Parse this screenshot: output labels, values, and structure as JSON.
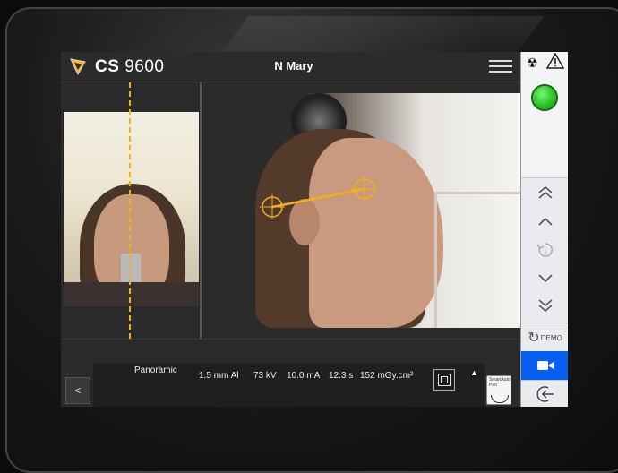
{
  "header": {
    "brand_prefix": "CS",
    "brand_model": "9600",
    "patient_name": "N Mary"
  },
  "icons": {
    "logo": "logo-icon",
    "menu": "menu-icon",
    "radiation": "radiation-icon",
    "warning": "warning-icon",
    "ready": "ready-indicator",
    "fast_up": "double-chevron-up-icon",
    "up": "chevron-up-icon",
    "reset": "reset-icon",
    "down": "chevron-down-icon",
    "fast_down": "double-chevron-down-icon",
    "camera": "camera-icon",
    "exit": "exit-icon"
  },
  "right_panel": {
    "radiation_symbol": "☢",
    "demo_label": "DEMO"
  },
  "exposure": {
    "back_label": "<",
    "program": "Panoramic",
    "filtration": "1.5 mm Al",
    "voltage": "73 kV",
    "current": "10.0 mA",
    "time": "12.3 s",
    "dose": "152 mGy.cm²",
    "expand_label": "▲",
    "smart_label": "SmartAuto Pan"
  },
  "colors": {
    "accent_blue": "#0a5ff0",
    "guide_line": "#f2b01e",
    "ready_green": "#2bc129"
  }
}
